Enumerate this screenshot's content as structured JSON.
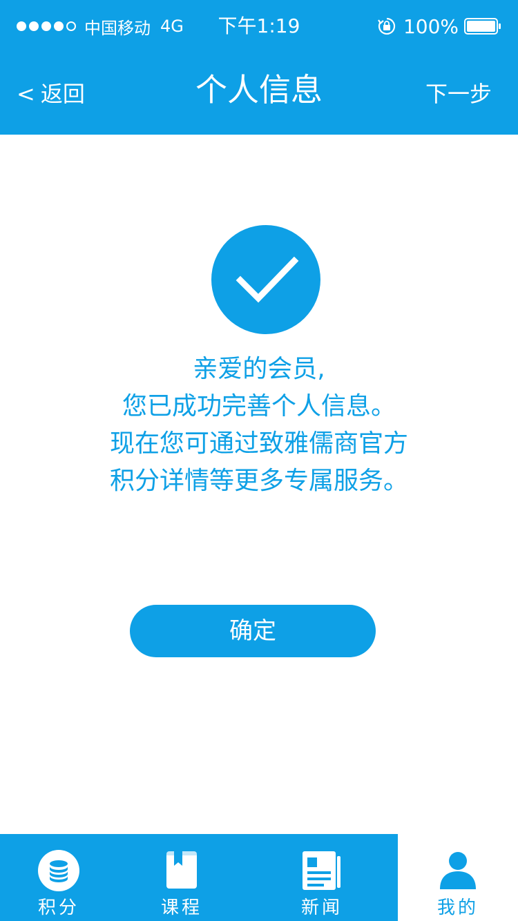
{
  "status_bar": {
    "carrier": "中国移动",
    "network": "4G",
    "time": "下午1:19",
    "battery_percent": "100%",
    "signal_strength": 4
  },
  "nav": {
    "back_label": "返回",
    "back_icon": "<",
    "title": "个人信息",
    "next_label": "下一步"
  },
  "message": {
    "lines": [
      "亲爱的会员,",
      "您已成功完善个人信息。",
      "现在您可通过致雅儒商官方",
      "积分详情等更多专属服务。"
    ]
  },
  "confirm_button": {
    "label": "确定"
  },
  "tabs": [
    {
      "label": "积分",
      "icon": "coins-icon",
      "active": false
    },
    {
      "label": "课程",
      "icon": "bookmark-book-icon",
      "active": false
    },
    {
      "label": "新闻",
      "icon": "newspaper-icon",
      "active": false
    },
    {
      "label": "我的",
      "icon": "user-icon",
      "active": true
    }
  ],
  "colors": {
    "primary": "#0ea0e6",
    "background": "#ffffff"
  }
}
